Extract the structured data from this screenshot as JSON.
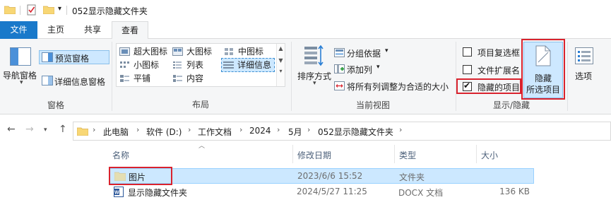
{
  "window": {
    "title": "052显示隐藏文件夹",
    "qat_dropdown": "▾"
  },
  "tabs": [
    {
      "label": "文件"
    },
    {
      "label": "主页"
    },
    {
      "label": "共享"
    },
    {
      "label": "查看"
    }
  ],
  "ribbon": {
    "panes": {
      "label": "窗格",
      "nav_pane": "导航窗格",
      "preview_pane": "预览窗格",
      "details_pane": "详细信息窗格"
    },
    "layout": {
      "label": "布局",
      "items": [
        "超大图标",
        "大图标",
        "中图标",
        "小图标",
        "列表",
        "详细信息",
        "平铺",
        "内容"
      ]
    },
    "current_view": {
      "label": "当前视图",
      "sort_by": "排序方式",
      "group_by": "分组依据",
      "add_column": "添加列",
      "fit_columns": "将所有列调整为合适的大小"
    },
    "show_hide": {
      "label": "显示/隐藏",
      "item_checkboxes": "项目复选框",
      "file_extensions": "文件扩展名",
      "hidden_items": "隐藏的项目",
      "hide_selected_line1": "隐藏",
      "hide_selected_line2": "所选项目",
      "options": "选项"
    }
  },
  "address": {
    "crumbs": [
      "此电脑",
      "软件 (D:)",
      "工作文档",
      "2024",
      "5月",
      "052显示隐藏文件夹"
    ]
  },
  "columns": {
    "name": "名称",
    "modified": "修改日期",
    "type": "类型",
    "size": "大小"
  },
  "files": [
    {
      "name": "图片",
      "modified": "2023/6/6 15:52",
      "type": "文件夹",
      "size": ""
    },
    {
      "name": "显示隐藏文件夹",
      "modified": "2024/5/27 11:25",
      "type": "DOCX 文档",
      "size": "136 KB"
    }
  ],
  "states": {
    "item_checkboxes_checked": false,
    "file_extensions_checked": false,
    "hidden_items_checked": true
  },
  "colors": {
    "accent": "#1979ca",
    "highlight_box": "#d9232e",
    "selection": "#cce8ff",
    "folder": "#f8d775"
  }
}
